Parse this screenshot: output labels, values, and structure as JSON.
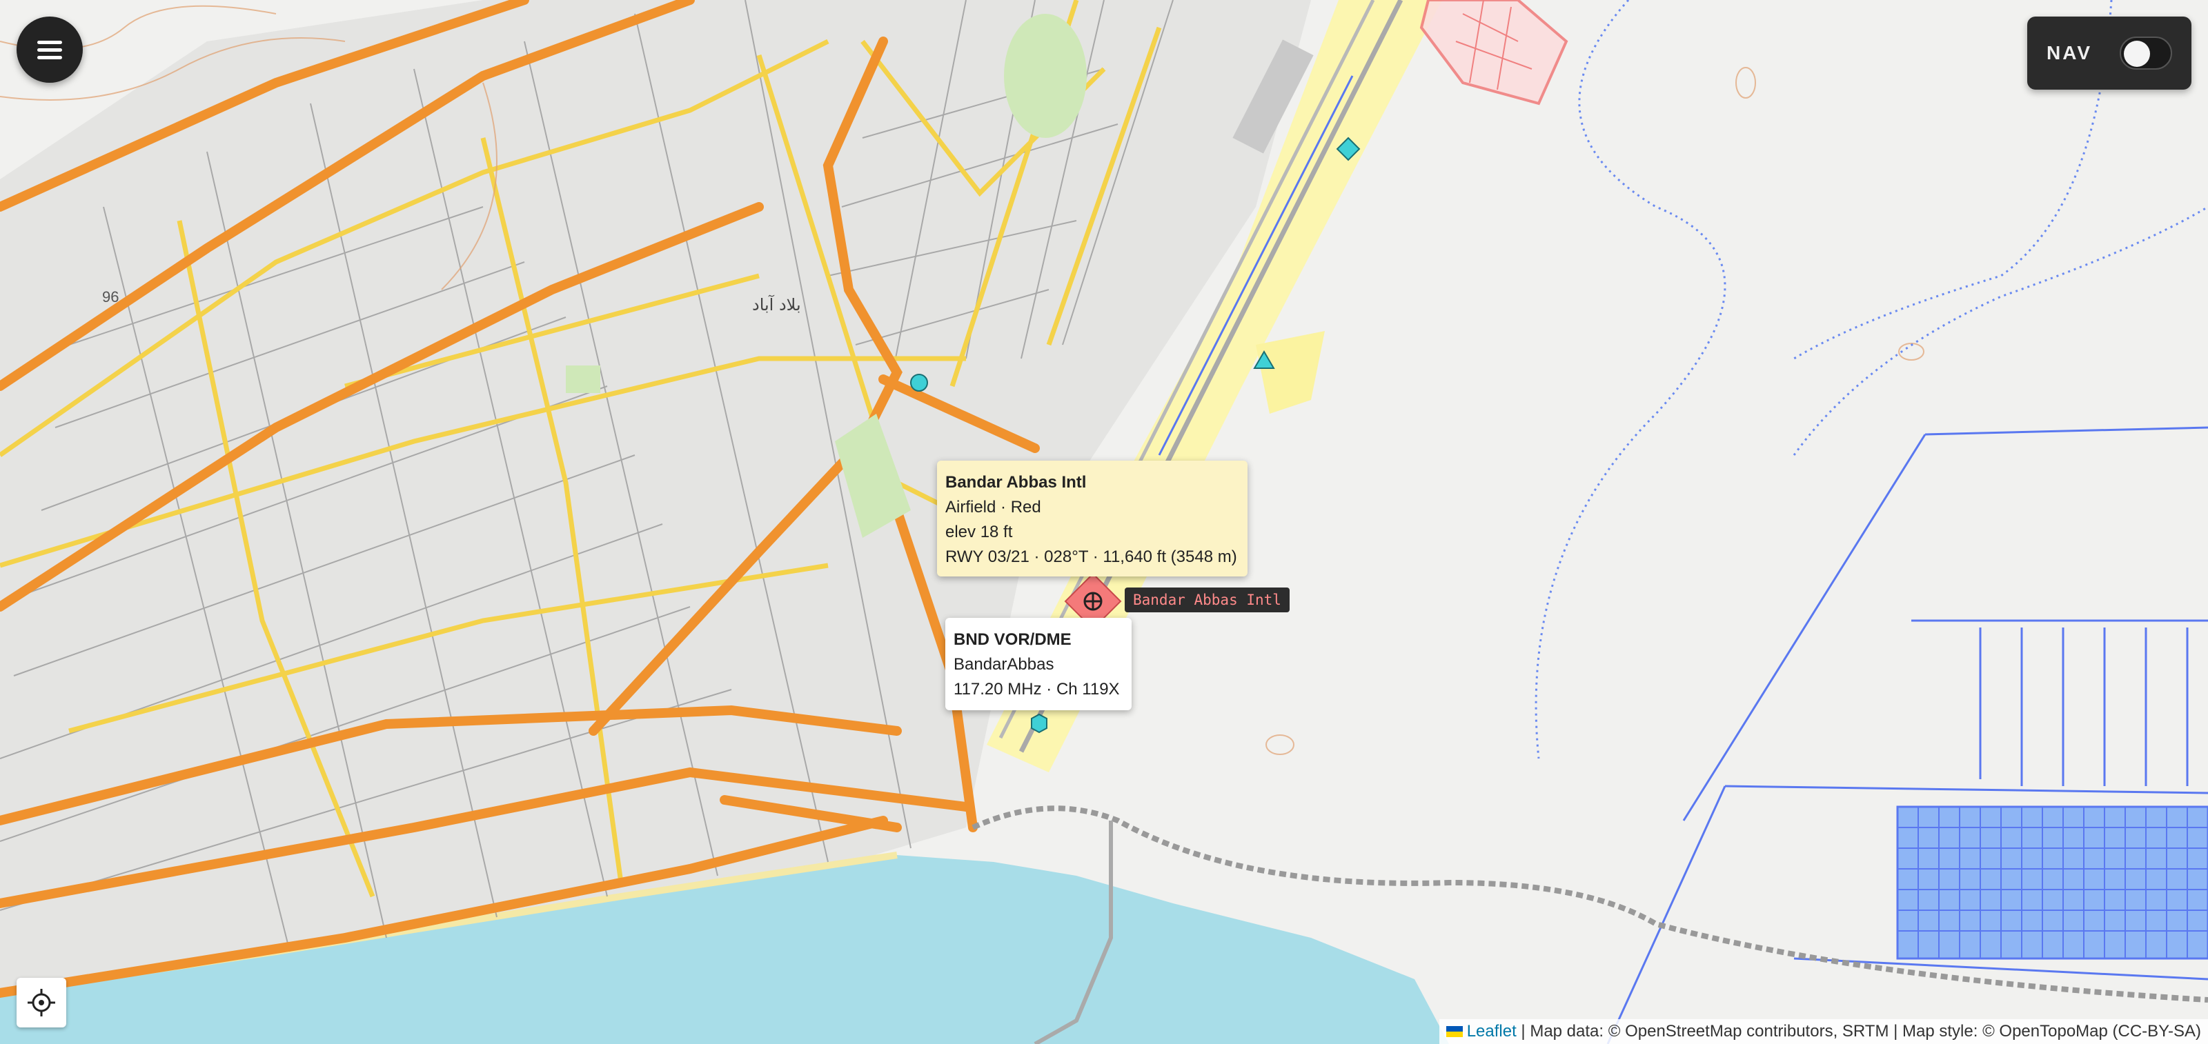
{
  "controls": {
    "menu_icon": "hamburger-menu-icon",
    "nav_label": "NAV",
    "nav_toggle_on": false,
    "locate_icon": "crosshair-locate-icon"
  },
  "airfield_popup": {
    "title": "Bandar Abbas Intl",
    "line1": "Airfield · Red",
    "line2": "elev 18 ft",
    "line3": "RWY 03/21 · 028°T · 11,640 ft (3548 m)"
  },
  "navaid_popup": {
    "title": "BND VOR/DME",
    "line1": "BandarAbbas",
    "line2": "117.20 MHz · Ch 119X"
  },
  "marker_label": "Bandar Abbas Intl",
  "map_labels": {
    "arabic_label": "بلاد آباد",
    "road_number": "96"
  },
  "attribution": {
    "leaflet": "Leaflet",
    "rest": " | Map data: © OpenStreetMap contributors, SRTM | Map style: © OpenTopoMap (CC-BY-SA)"
  },
  "colors": {
    "sea": "#a8dde8",
    "land": "#f2f2f0",
    "major_road": "#f0922e",
    "minor_road": "#f4d24a",
    "runway_zone": "#fdf6a8",
    "airfield_marker": "#f47a7a",
    "cyan_marker": "#3fd0d6",
    "water_line": "#5a78f0"
  }
}
